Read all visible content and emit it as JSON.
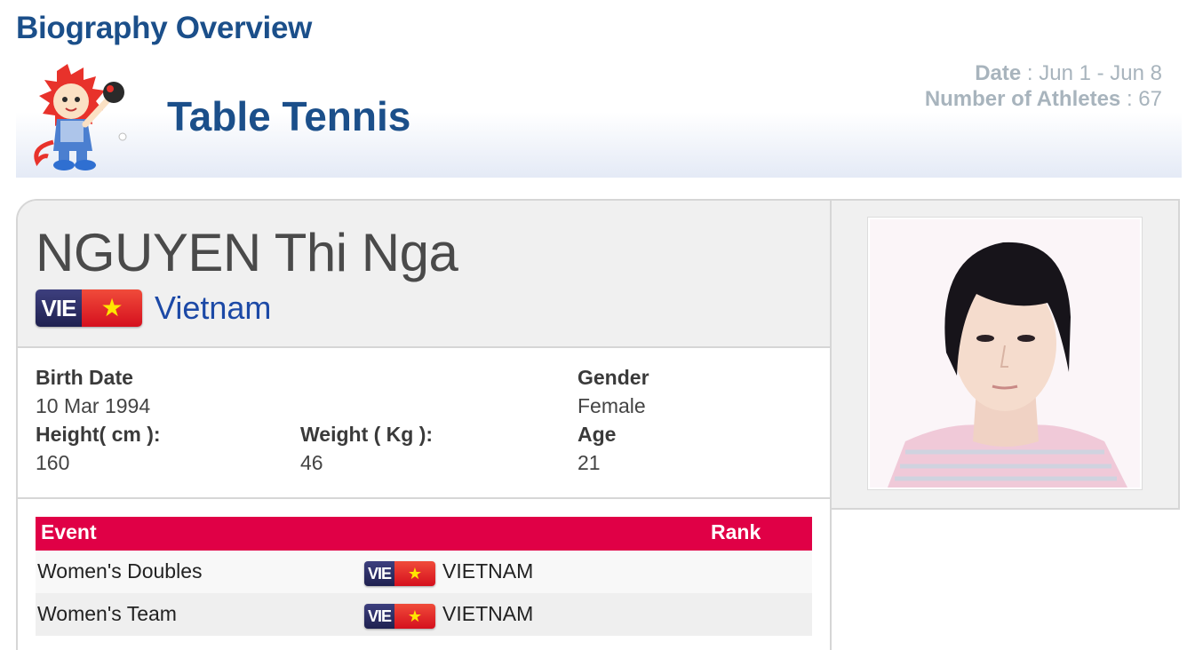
{
  "page": {
    "heading": "Biography Overview"
  },
  "banner": {
    "sport": "Table Tennis",
    "date_label": "Date",
    "date_value": "Jun 1 - Jun 8",
    "athletes_label": "Number of Athletes",
    "athletes_value": "67",
    "separator": " : "
  },
  "athlete": {
    "name": "NGUYEN Thi Nga",
    "country_code": "VIE",
    "country": "Vietnam",
    "birth_date_label": "Birth Date",
    "birth_date": "10 Mar 1994",
    "gender_label": "Gender",
    "gender": "Female",
    "height_label": "Height( cm ):",
    "height": "160",
    "weight_label": "Weight ( Kg ):",
    "weight": "46",
    "age_label": "Age",
    "age": "21"
  },
  "events": {
    "header_event": "Event",
    "header_rank": "Rank",
    "rows": [
      {
        "event": "Women's Doubles",
        "code": "VIE",
        "country": "VIETNAM"
      },
      {
        "event": "Women's Team",
        "code": "VIE",
        "country": "VIETNAM"
      }
    ]
  },
  "colors": {
    "brand_blue": "#1b4f8a",
    "accent_red": "#e00046",
    "link_blue": "#1c49a6",
    "meta_gray": "#a8b4bd"
  },
  "icons": {
    "mascot": "lion-mascot-table-tennis-icon",
    "flag": "vietnam-flag-icon",
    "star": "★"
  }
}
